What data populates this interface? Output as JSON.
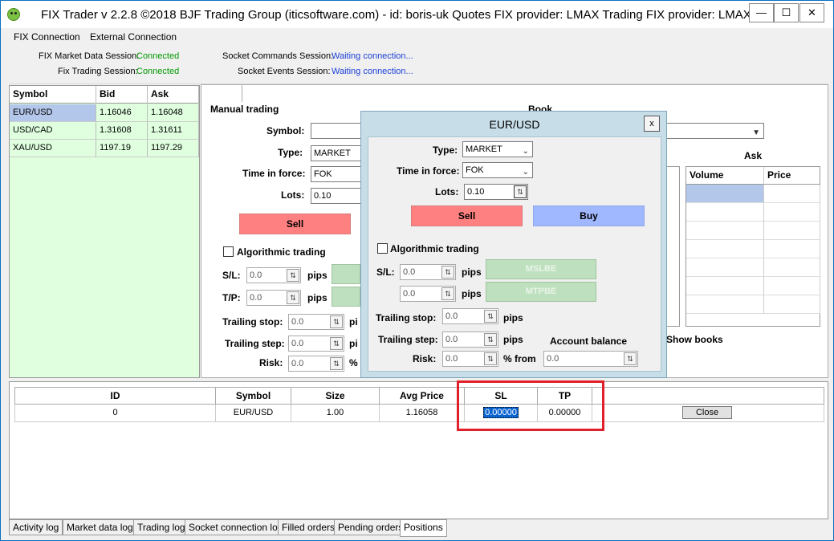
{
  "window": {
    "title": "FIX Trader v 2.2.8 ©2018 BJF Trading Group (iticsoftware.com) - id: boris-uk Quotes FIX provider: LMAX Trading FIX provider: LMAX",
    "minimize": "—",
    "maximize": "☐",
    "close": "✕"
  },
  "menu": {
    "fix_connection": "FIX Connection",
    "external_connection": "External Connection"
  },
  "sessions": {
    "market_data_label": "FIX Market Data Session:",
    "market_data_status": "Connected",
    "trading_label": "Fix Trading Session:",
    "trading_status": "Connected",
    "socket_commands_label": "Socket Commands Session:",
    "socket_commands_status": "Waiting connection...",
    "socket_events_label": "Socket Events Session:",
    "socket_events_status": "Waiting connection..."
  },
  "quotes": {
    "headers": [
      "Symbol",
      "Bid",
      "Ask"
    ],
    "rows": [
      [
        "EUR/USD",
        "1.16046",
        "1.16048"
      ],
      [
        "USD/CAD",
        "1.31608",
        "1.31611"
      ],
      [
        "XAU/USD",
        "1197.19",
        "1197.29"
      ]
    ]
  },
  "manual": {
    "section_title": "Manual trading",
    "symbol_label": "Symbol:",
    "type_label": "Type:",
    "type_value": "MARKET",
    "tif_label": "Time in force:",
    "tif_value": "FOK",
    "lots_label": "Lots:",
    "lots_value": "0.10",
    "sell_label": "Sell",
    "algo_label": "Algorithmic trading",
    "sl_label": "S/L:",
    "sl_value": "0.0",
    "tp_label": "T/P:",
    "tp_value": "0.0",
    "pips": "pips",
    "trailing_stop_label": "Trailing stop:",
    "trailing_stop_value": "0.0",
    "trailing_step_label": "Trailing step:",
    "trailing_step_value": "0.0",
    "risk_label": "Risk:",
    "risk_value": "0.0",
    "percent": "%"
  },
  "book": {
    "title": "Book",
    "ask_label": "Ask",
    "headers": [
      "Volume",
      "Price"
    ],
    "show_books": "Show books"
  },
  "dialog": {
    "title": "EUR/USD",
    "close": "x",
    "type_label": "Type:",
    "type_value": "MARKET",
    "tif_label": "Time in force:",
    "tif_value": "FOK",
    "lots_label": "Lots:",
    "lots_value": "0.10",
    "sell_label": "Sell",
    "buy_label": "Buy",
    "algo_label": "Algorithmic trading",
    "sl_label": "S/L:",
    "sl_value": "0.0",
    "tp_value": "0.0",
    "pips": "pips",
    "mslbe": "MSLBE",
    "mtpbe": "MTPBE",
    "trailing_stop_label": "Trailing stop:",
    "trailing_stop_value": "0.0",
    "trailing_step_label": "Trailing step:",
    "trailing_step_value": "0.0",
    "account_balance_label": "Account balance",
    "risk_label": "Risk:",
    "risk_value": "0.0",
    "percent_from": "% from",
    "balance_value": "0.0"
  },
  "positions": {
    "headers": [
      "ID",
      "Symbol",
      "Size",
      "Avg Price",
      "SL",
      "TP"
    ],
    "row": [
      "0",
      "EUR/USD",
      "1.00",
      "1.16058",
      "0.00000",
      "0.00000"
    ],
    "close_label": "Close"
  },
  "bottom_tabs": [
    "Activity log",
    "Market data log",
    "Trading log",
    "Socket connection log",
    "Filled orders",
    "Pending orders",
    "Positions"
  ],
  "colors": {
    "connected": "#009900",
    "waiting": "#1a3fd8",
    "sell": "#ff8080",
    "buy": "#9fb8ff",
    "highlight": "#e0202a"
  }
}
